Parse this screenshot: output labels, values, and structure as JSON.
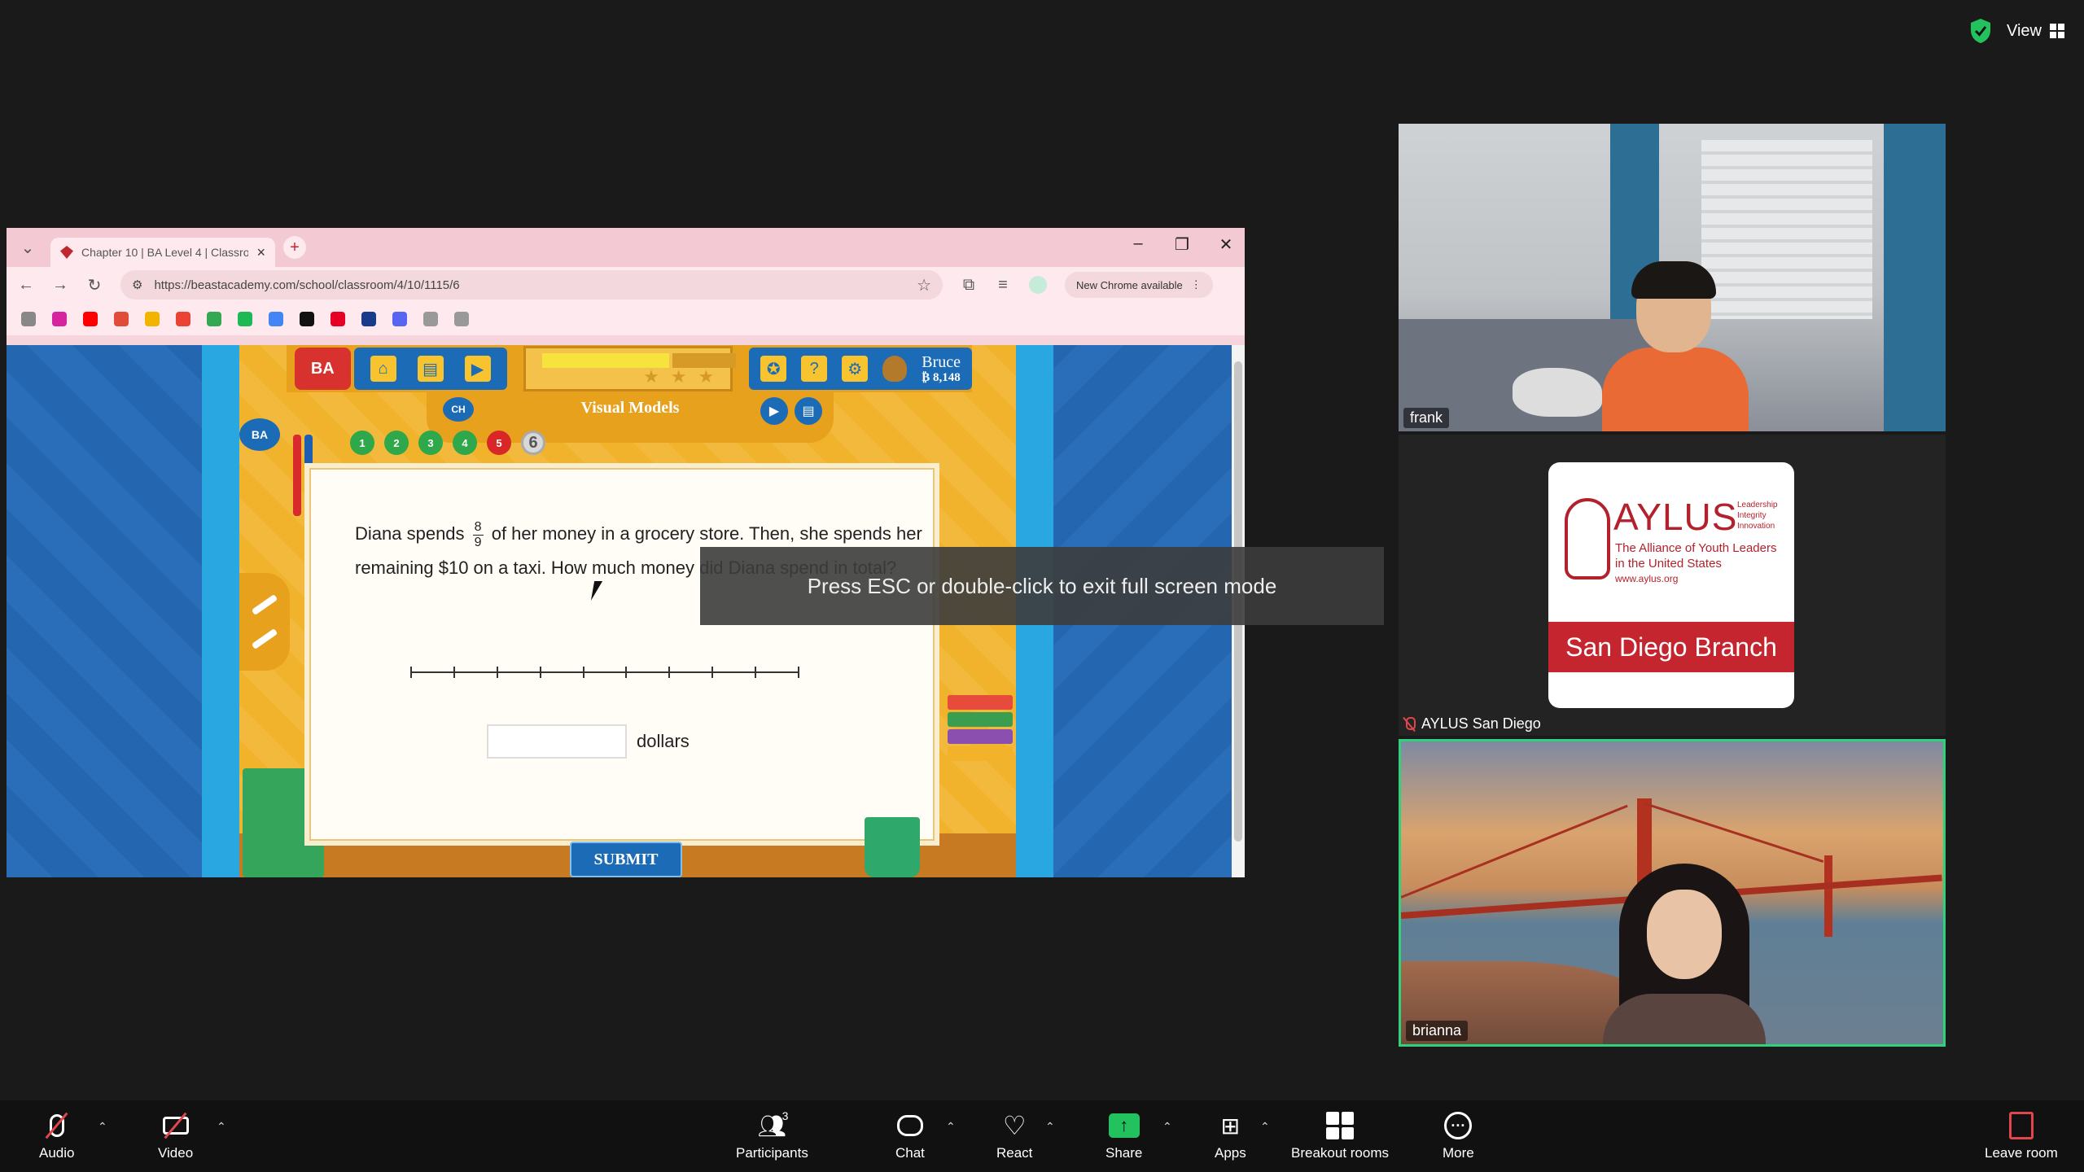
{
  "topbar": {
    "view_label": "View"
  },
  "browser": {
    "tab_title": "Chapter 10 | BA Level 4 | Classroom",
    "url": "https://beastacademy.com/school/classroom/4/10/1115/6",
    "chrome_update": "New Chrome available"
  },
  "game": {
    "logo": "BA",
    "user_name": "Bruce",
    "user_points": "₿ 8,148",
    "section_title": "Visual Models",
    "chapter_badge": "CH",
    "side_badge": "BA",
    "steps": [
      {
        "label": "1",
        "status": "correct"
      },
      {
        "label": "2",
        "status": "correct"
      },
      {
        "label": "3",
        "status": "correct"
      },
      {
        "label": "4",
        "status": "correct"
      },
      {
        "label": "5",
        "status": "incorrect"
      },
      {
        "label": "6",
        "status": "current"
      }
    ],
    "question_part1": "Diana spends",
    "fraction_num": "8",
    "fraction_den": "9",
    "question_part2": "of her money in a grocery store. Then, she spends her remaining $10 on a taxi. How much money did Diana spend in total?",
    "answer_unit": "dollars",
    "submit_label": "SUBMIT",
    "progress": 0.6
  },
  "toast": "Press ESC or double-click to exit full screen mode",
  "participants": [
    {
      "name": "frank"
    },
    {
      "name": "AYLUS San Diego"
    },
    {
      "name": "brianna"
    }
  ],
  "aylus_card": {
    "word": "AYLUS",
    "tags": [
      "Leadership",
      "Integrity",
      "Innovation"
    ],
    "subtitle_line1": "The Alliance of Youth Leaders",
    "subtitle_line2": "in the United States",
    "url": "www.aylus.org",
    "branch": "San Diego Branch"
  },
  "toolbar": {
    "audio": "Audio",
    "video": "Video",
    "participants": "Participants",
    "participants_count": "3",
    "chat": "Chat",
    "react": "React",
    "share": "Share",
    "apps": "Apps",
    "breakout": "Breakout rooms",
    "more": "More",
    "leave": "Leave room"
  }
}
